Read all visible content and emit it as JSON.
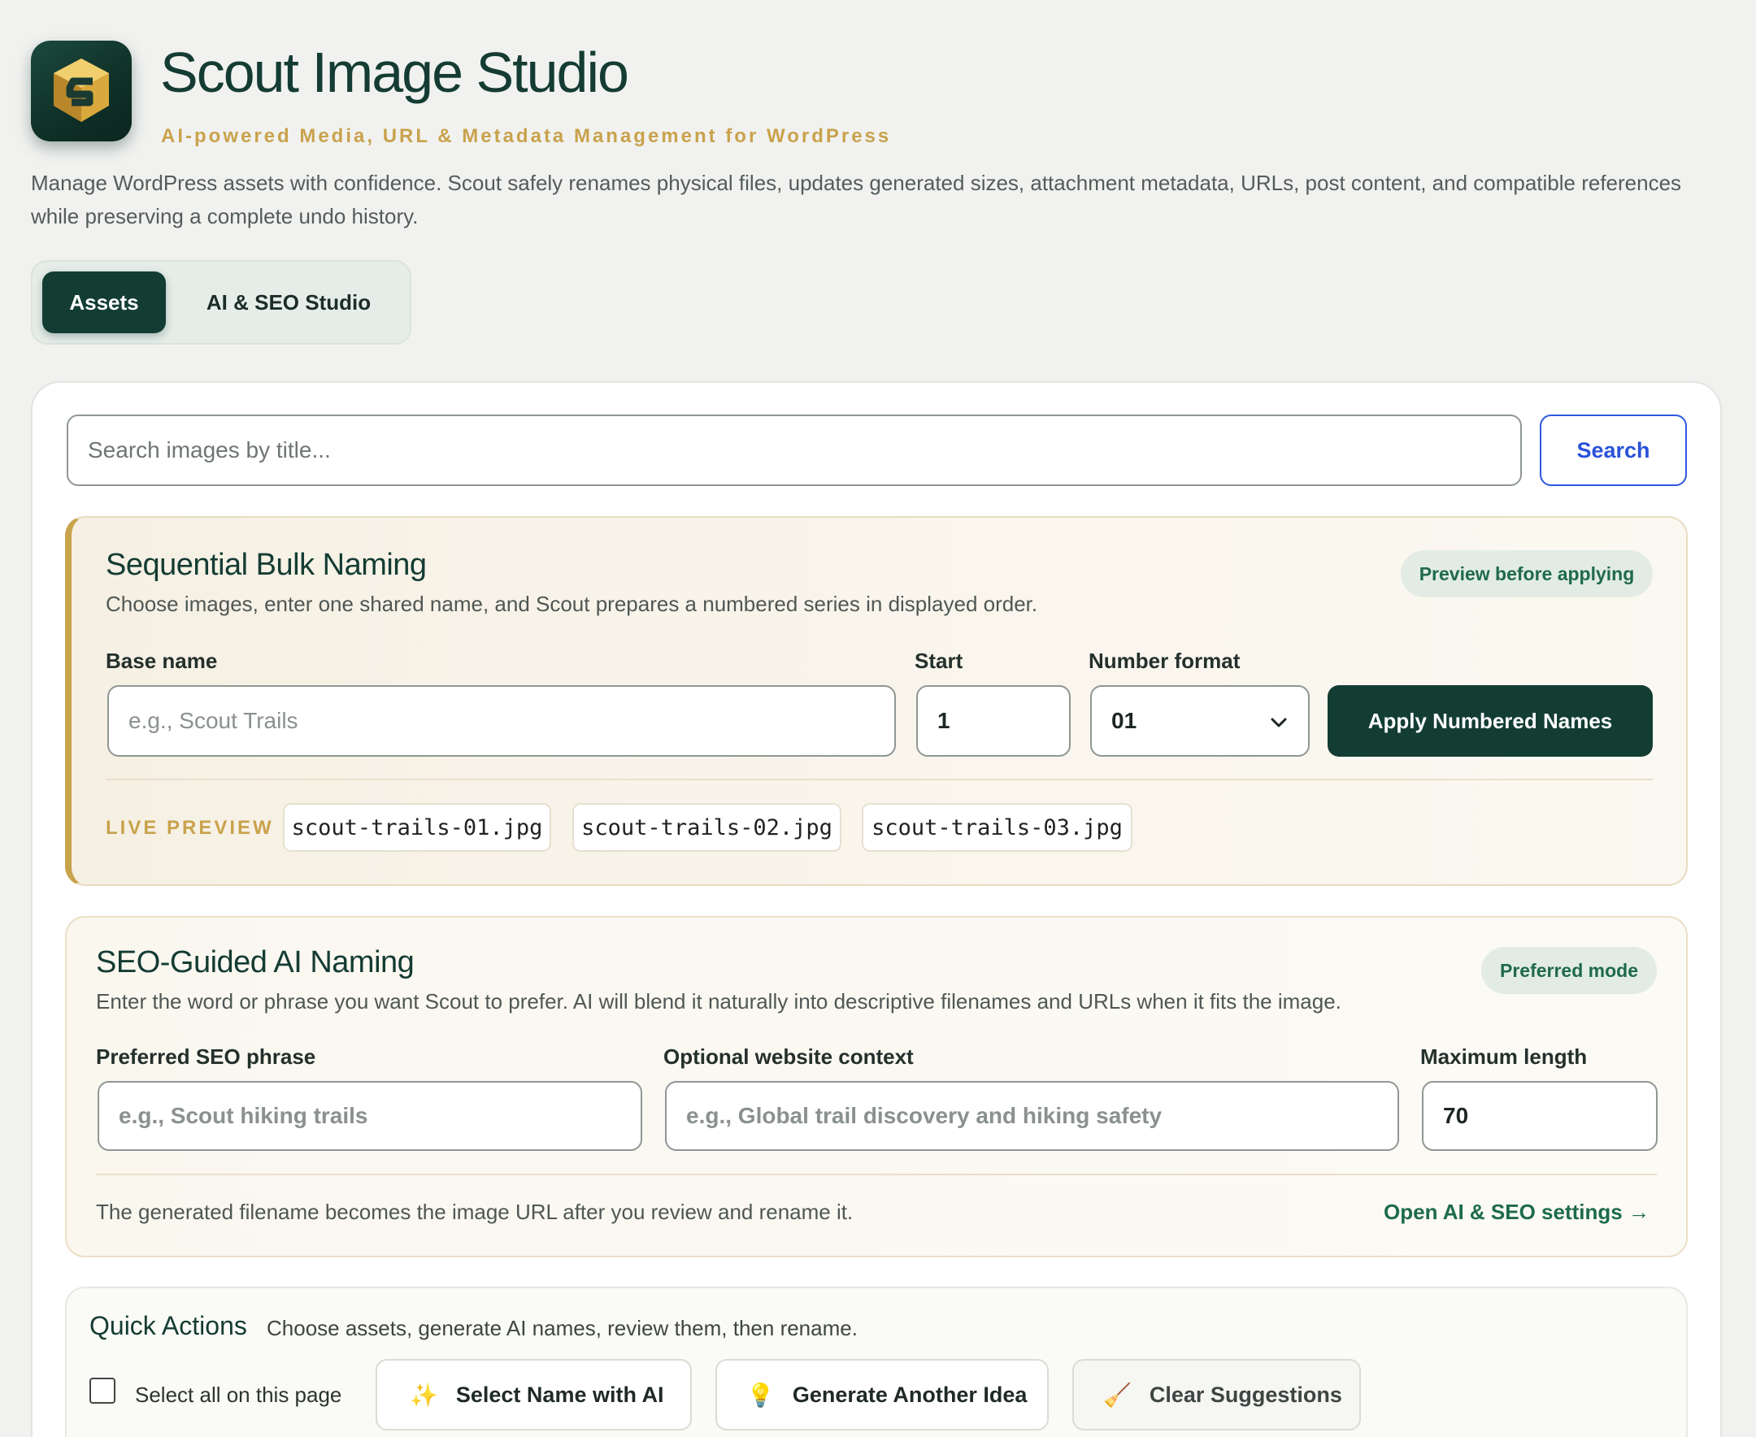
{
  "header": {
    "title": "Scout Image Studio",
    "tagline": "AI-powered Media, URL & Metadata Management for WordPress",
    "description": "Manage WordPress assets with confidence. Scout safely renames physical files, updates generated sizes, attachment metadata, URLs, post content, and compatible references while preserving a complete undo history."
  },
  "tabs": [
    {
      "label": "Assets",
      "active": true
    },
    {
      "label": "AI & SEO Studio",
      "active": false
    }
  ],
  "search": {
    "placeholder": "Search images by title...",
    "button_label": "Search"
  },
  "sequential": {
    "title": "Sequential Bulk Naming",
    "subtitle": "Choose images, enter one shared name, and Scout prepares a numbered series in displayed order.",
    "badge": "Preview before applying",
    "base_name_label": "Base name",
    "base_name_placeholder": "e.g., Scout Trails",
    "start_label": "Start",
    "start_value": "1",
    "format_label": "Number format",
    "format_value": "01",
    "apply_label": "Apply Numbered Names",
    "live_preview_label": "LIVE PREVIEW",
    "previews": [
      "scout-trails-01.jpg",
      "scout-trails-02.jpg",
      "scout-trails-03.jpg"
    ]
  },
  "seo": {
    "title": "SEO-Guided AI Naming",
    "subtitle": "Enter the word or phrase you want Scout to prefer. AI will blend it naturally into descriptive filenames and URLs when it fits the image.",
    "badge": "Preferred mode",
    "phrase_label": "Preferred SEO phrase",
    "phrase_placeholder": "e.g., Scout hiking trails",
    "context_label": "Optional website context",
    "context_placeholder": "e.g., Global trail discovery and hiking safety",
    "max_label": "Maximum length",
    "max_value": "70",
    "footer_text": "The generated filename becomes the image URL after you review and rename it.",
    "settings_link": "Open AI & SEO settings →"
  },
  "quick_actions": {
    "title": "Quick Actions",
    "subtitle": "Choose assets, generate AI names, review them, then rename.",
    "select_all_label": "Select all on this page",
    "buttons": [
      {
        "label": "Select Name with AI",
        "icon": "✨"
      },
      {
        "label": "Generate Another Idea",
        "icon": "💡"
      },
      {
        "label": "Clear Suggestions",
        "icon": "🧹"
      }
    ]
  },
  "colors": {
    "brand_dark": "#133d33",
    "accent_gold": "#c9a24c",
    "link_blue": "#2a52d8",
    "success_green": "#1d6b49"
  }
}
